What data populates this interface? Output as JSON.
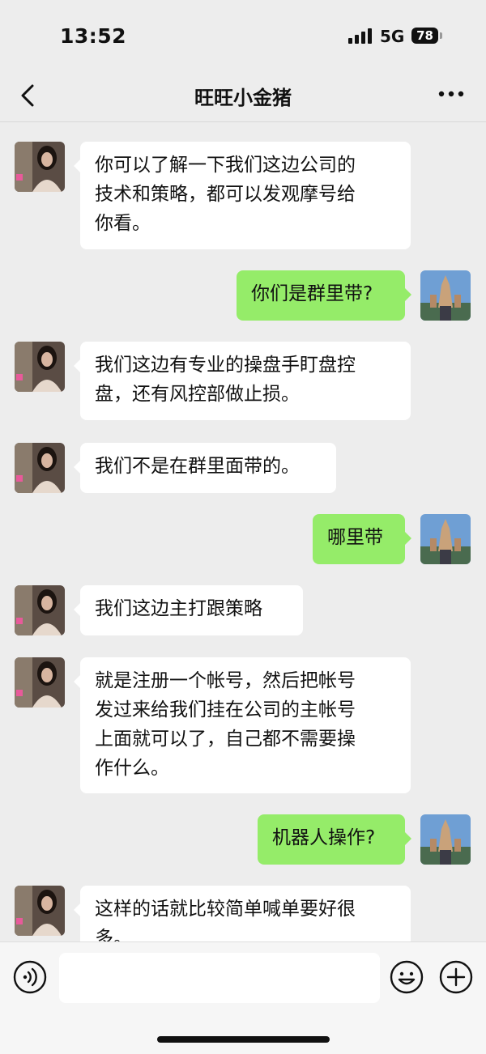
{
  "status_bar": {
    "time": "13:52",
    "network": "5G",
    "battery": "78"
  },
  "header": {
    "title": "旺旺小金猪",
    "back_icon": "chevron-left-icon",
    "more_icon": "more-dots-icon"
  },
  "messages": [
    {
      "side": "in",
      "text": "你可以了解一下我们这边公司的\n技术和策略，都可以发观摩号给\n你看。"
    },
    {
      "side": "out",
      "text": "你们是群里带?"
    },
    {
      "side": "in",
      "text": "我们这边有专业的操盘手盯盘控\n盘，还有风控部做止损。"
    },
    {
      "side": "in",
      "text": "我们不是在群里面带的。"
    },
    {
      "side": "out",
      "text": "哪里带"
    },
    {
      "side": "in",
      "text": "我们这边主打跟策略"
    },
    {
      "side": "in",
      "text": "就是注册一个帐号，然后把帐号\n发过来给我们挂在公司的主帐号\n上面就可以了，自己都不需要操\n作什么。"
    },
    {
      "side": "out",
      "text": "机器人操作?"
    },
    {
      "side": "in",
      "text": "这样的话就比较简单喊单要好很\n多。"
    }
  ],
  "input_bar": {
    "voice_icon": "voice-icon",
    "placeholder": "",
    "emoji_icon": "emoji-icon",
    "plus_icon": "plus-icon"
  },
  "colors": {
    "background": "#ededed",
    "incoming_bubble": "#ffffff",
    "outgoing_bubble": "#95ec69"
  }
}
